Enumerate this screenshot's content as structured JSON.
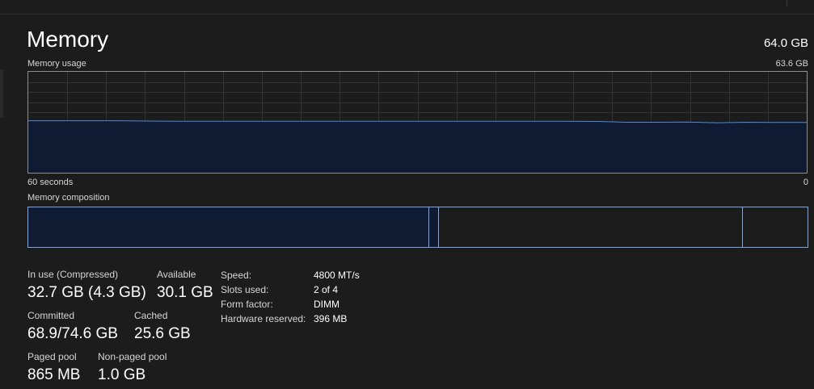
{
  "header": {
    "title": "Memory",
    "total": "64.0 GB"
  },
  "graph": {
    "label": "Memory usage",
    "max_label": "63.6 GB",
    "time_label": "60 seconds",
    "min_label": "0",
    "fill_color": "#0e1b33",
    "line_color": "#4f86d9",
    "grid_color": "#333333",
    "usage_samples_fraction": [
      0.515,
      0.515,
      0.515,
      0.515,
      0.512,
      0.51,
      0.51,
      0.51,
      0.51,
      0.51,
      0.51,
      0.51,
      0.51,
      0.51,
      0.51,
      0.51,
      0.51,
      0.51,
      0.51,
      0.508,
      0.5,
      0.5,
      0.502,
      0.495,
      0.5,
      0.498,
      0.498
    ]
  },
  "composition": {
    "label": "Memory composition",
    "in_use_gb": 32.7,
    "modified_gb": 0.8,
    "standby_gb": 24.8,
    "free_gb": 5.3,
    "total_gb": 63.6
  },
  "stats": {
    "in_use": {
      "label": "In use (Compressed)",
      "value": "32.7 GB (4.3 GB)"
    },
    "available": {
      "label": "Available",
      "value": "30.1 GB"
    },
    "committed": {
      "label": "Committed",
      "value": "68.9/74.6 GB"
    },
    "cached": {
      "label": "Cached",
      "value": "25.6 GB"
    },
    "paged_pool": {
      "label": "Paged pool",
      "value": "865 MB"
    },
    "non_paged_pool": {
      "label": "Non-paged pool",
      "value": "1.0 GB"
    }
  },
  "details": [
    {
      "key": "Speed:",
      "value": "4800 MT/s"
    },
    {
      "key": "Slots used:",
      "value": "2 of 4"
    },
    {
      "key": "Form factor:",
      "value": "DIMM"
    },
    {
      "key": "Hardware reserved:",
      "value": "396 MB"
    }
  ]
}
